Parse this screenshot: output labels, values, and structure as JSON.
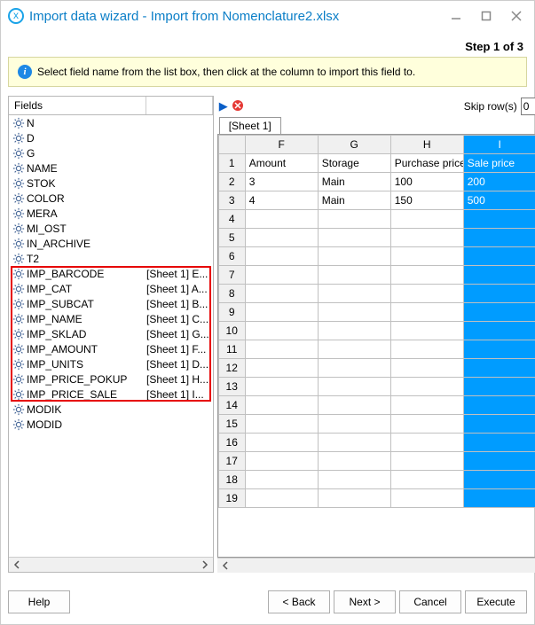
{
  "window": {
    "title": "Import data wizard - Import from Nomenclature2.xlsx",
    "step_label": "Step 1 of 3"
  },
  "info_text": "Select field name from the list box, then click at the column to import this field to.",
  "fields_header": {
    "col1": "Fields",
    "col2": ""
  },
  "fields": [
    {
      "name": "N",
      "map": ""
    },
    {
      "name": "D",
      "map": ""
    },
    {
      "name": "G",
      "map": ""
    },
    {
      "name": "NAME",
      "map": ""
    },
    {
      "name": "STOK",
      "map": ""
    },
    {
      "name": "COLOR",
      "map": ""
    },
    {
      "name": "MERA",
      "map": ""
    },
    {
      "name": "MI_OST",
      "map": ""
    },
    {
      "name": "IN_ARCHIVE",
      "map": ""
    },
    {
      "name": "T2",
      "map": ""
    },
    {
      "name": "IMP_BARCODE",
      "map": "[Sheet 1] E..."
    },
    {
      "name": "IMP_CAT",
      "map": "[Sheet 1] A..."
    },
    {
      "name": "IMP_SUBCAT",
      "map": "[Sheet 1] B..."
    },
    {
      "name": "IMP_NAME",
      "map": "[Sheet 1] C..."
    },
    {
      "name": "IMP_SKLAD",
      "map": "[Sheet 1] G..."
    },
    {
      "name": "IMP_AMOUNT",
      "map": "[Sheet 1] F..."
    },
    {
      "name": "IMP_UNITS",
      "map": "[Sheet 1] D..."
    },
    {
      "name": "IMP_PRICE_POKUP",
      "map": "[Sheet 1] H..."
    },
    {
      "name": "IMP_PRICE_SALE",
      "map": "[Sheet 1] I..."
    },
    {
      "name": "MODIK",
      "map": ""
    },
    {
      "name": "MODID",
      "map": ""
    }
  ],
  "right": {
    "skip_label": "Skip row(s)",
    "skip_value": "0",
    "tab": "[Sheet 1]",
    "cols": [
      "F",
      "G",
      "H",
      "I"
    ],
    "selected_col_index": 3,
    "rows": [
      [
        "Amount",
        "Storage",
        "Purchase price",
        "Sale price"
      ],
      [
        "3",
        "Main",
        "100",
        "200"
      ],
      [
        "4",
        "Main",
        "150",
        "500"
      ],
      [
        "",
        "",
        "",
        ""
      ],
      [
        "",
        "",
        "",
        ""
      ],
      [
        "",
        "",
        "",
        ""
      ],
      [
        "",
        "",
        "",
        ""
      ],
      [
        "",
        "",
        "",
        ""
      ],
      [
        "",
        "",
        "",
        ""
      ],
      [
        "",
        "",
        "",
        ""
      ],
      [
        "",
        "",
        "",
        ""
      ],
      [
        "",
        "",
        "",
        ""
      ],
      [
        "",
        "",
        "",
        ""
      ],
      [
        "",
        "",
        "",
        ""
      ],
      [
        "",
        "",
        "",
        ""
      ],
      [
        "",
        "",
        "",
        ""
      ],
      [
        "",
        "",
        "",
        ""
      ],
      [
        "",
        "",
        "",
        ""
      ],
      [
        "",
        "",
        "",
        ""
      ]
    ]
  },
  "buttons": {
    "help": "Help",
    "back": "< Back",
    "next": "Next >",
    "cancel": "Cancel",
    "execute": "Execute"
  },
  "icons": {
    "play": "▶",
    "lock": "⦸"
  }
}
